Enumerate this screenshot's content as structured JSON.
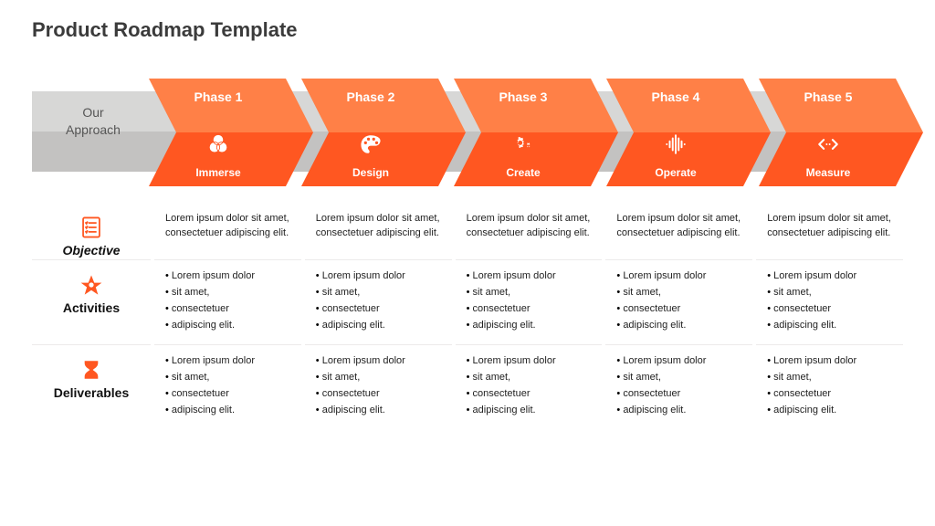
{
  "title": "Product Roadmap Template",
  "approach_label_1": "Our",
  "approach_label_2": "Approach",
  "phases": [
    {
      "phase": "Phase 1",
      "name": "Immerse"
    },
    {
      "phase": "Phase 2",
      "name": "Design"
    },
    {
      "phase": "Phase 3",
      "name": "Create"
    },
    {
      "phase": "Phase 4",
      "name": "Operate"
    },
    {
      "phase": "Phase 5",
      "name": "Measure"
    }
  ],
  "rows": {
    "objective": {
      "label": "Objective",
      "cells": [
        "Lorem ipsum dolor sit amet, consectetuer adipiscing elit.",
        "Lorem ipsum dolor sit amet, consectetuer adipiscing elit.",
        "Lorem ipsum dolor sit amet, consectetuer adipiscing elit.",
        "Lorem ipsum dolor sit amet, consectetuer adipiscing elit.",
        "Lorem ipsum dolor sit amet, consectetuer adipiscing elit."
      ]
    },
    "activities": {
      "label": "Activities",
      "cells": [
        [
          "Lorem ipsum dolor",
          "sit amet,",
          "consectetuer",
          "adipiscing elit."
        ],
        [
          "Lorem ipsum dolor",
          "sit amet,",
          "consectetuer",
          "adipiscing elit."
        ],
        [
          "Lorem ipsum dolor",
          "sit amet,",
          "consectetuer",
          "adipiscing elit."
        ],
        [
          "Lorem ipsum dolor",
          "sit amet,",
          "consectetuer",
          "adipiscing elit."
        ],
        [
          "Lorem ipsum dolor",
          "sit amet,",
          "consectetuer",
          "adipiscing elit."
        ]
      ]
    },
    "deliverables": {
      "label": "Deliverables",
      "cells": [
        [
          "Lorem ipsum dolor",
          "sit amet,",
          "consectetuer",
          "adipiscing elit."
        ],
        [
          "Lorem ipsum dolor",
          "sit amet,",
          "consectetuer",
          "adipiscing elit."
        ],
        [
          "Lorem ipsum dolor",
          "sit amet,",
          "consectetuer",
          "adipiscing elit."
        ],
        [
          "Lorem ipsum dolor",
          "sit amet,",
          "consectetuer",
          "adipiscing elit."
        ],
        [
          "Lorem ipsum dolor",
          "sit amet,",
          "consectetuer",
          "adipiscing elit."
        ]
      ]
    }
  }
}
